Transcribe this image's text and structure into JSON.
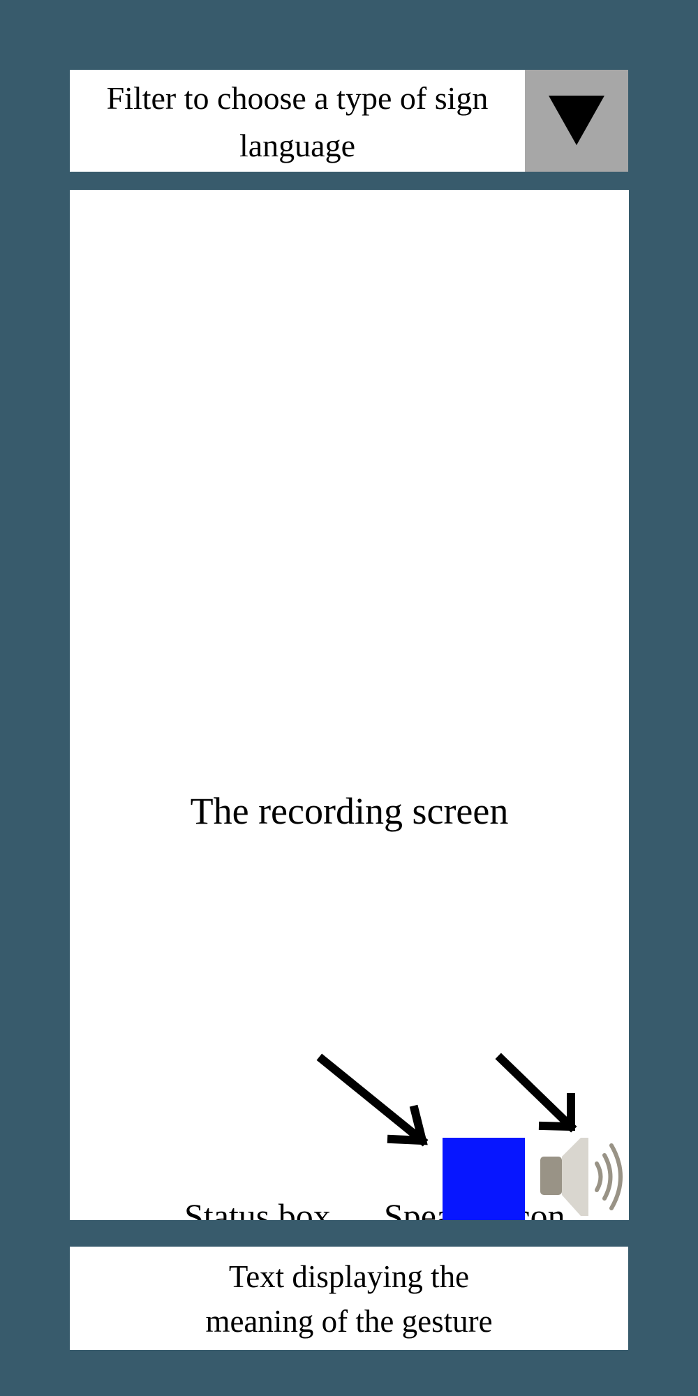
{
  "filter": {
    "label_line1": "Filter to choose a type of sign",
    "label_line2": "language",
    "button_icon": "triangle-down-icon"
  },
  "recording": {
    "label": "The recording screen"
  },
  "annotations": {
    "status_box": "Status box",
    "speaker_icon": "Speaker icon"
  },
  "status": {
    "color": "#0716ff"
  },
  "speaker": {
    "icon": "speaker-icon"
  },
  "meaning": {
    "line1": "Text displaying the",
    "line2": "meaning of the gesture"
  },
  "colors": {
    "background": "#385b6c",
    "filter_button": "#a7a7a7",
    "speaker_body": "#999386",
    "speaker_cone": "#d9d6cf"
  }
}
